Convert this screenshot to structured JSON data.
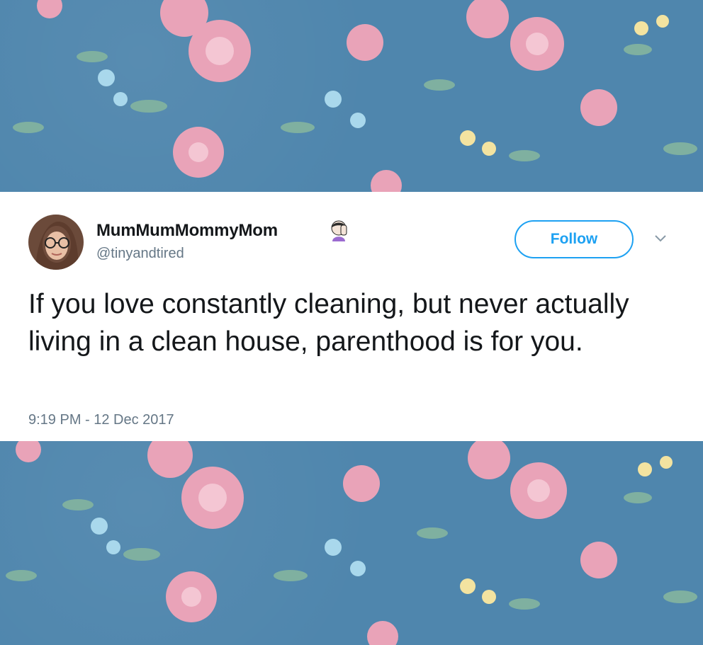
{
  "tweet": {
    "display_name": "MumMumMommyMom",
    "emoji_icon": "face-palm-woman-emoji",
    "handle": "@tinyandtired",
    "follow_label": "Follow",
    "caret_icon": "chevron-down-icon",
    "text": "If you love constantly cleaning, but never actually living in a clean house, parenthood is for you.",
    "timestamp": "9:19 PM - 12 Dec 2017"
  },
  "colors": {
    "accent": "#1da1f2",
    "text_primary": "#14171a",
    "text_secondary": "#657786",
    "background_fabric": "#4f86ad"
  }
}
